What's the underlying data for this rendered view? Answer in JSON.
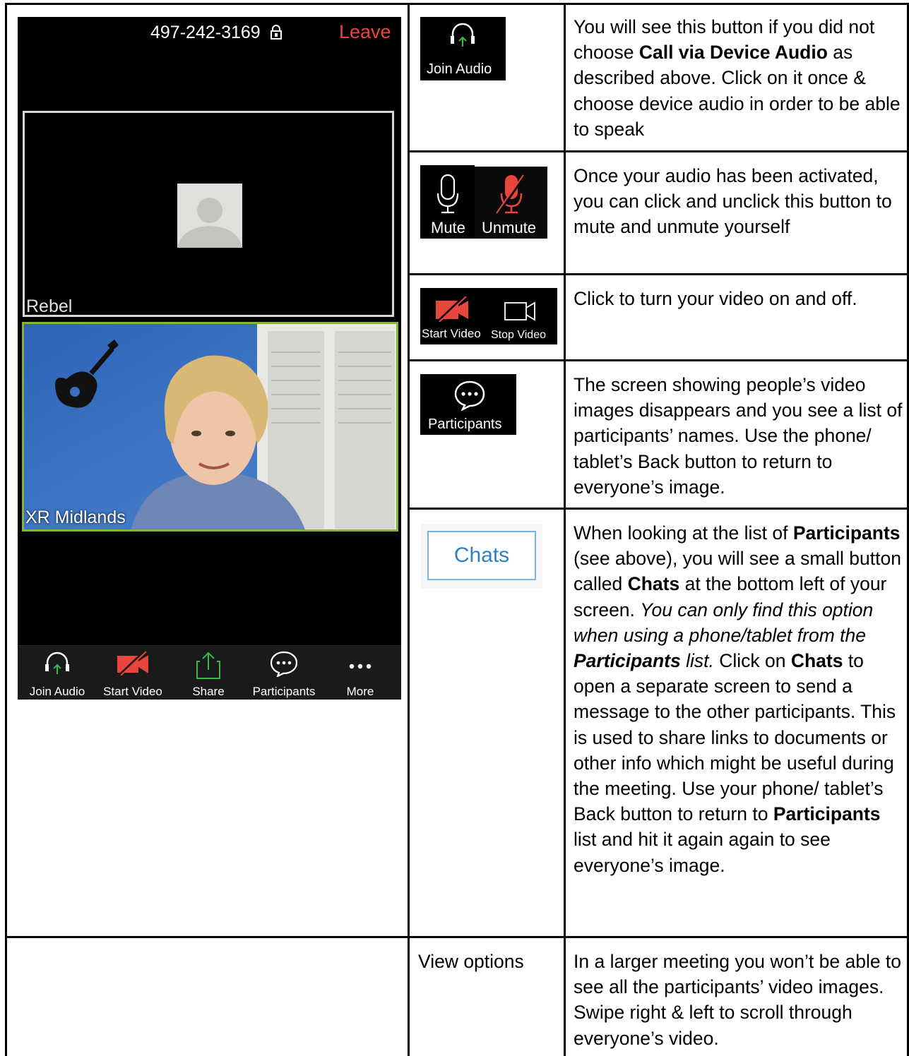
{
  "phone": {
    "meeting_id": "497-242-3169",
    "leave_label": "Leave",
    "tiles": [
      {
        "name": "Rebel"
      },
      {
        "name": "XR Midlands"
      }
    ],
    "toolbar": [
      {
        "label": "Join Audio",
        "icon": "headphones-icon"
      },
      {
        "label": "Start Video",
        "icon": "video-off-icon"
      },
      {
        "label": "Share",
        "icon": "share-icon"
      },
      {
        "label": "Participants",
        "icon": "chat-bubble-icon"
      },
      {
        "label": "More",
        "icon": "more-dots-icon"
      }
    ]
  },
  "rows": {
    "join_audio": {
      "btn_label": "Join Audio",
      "desc_1": "You will see this button if you did not choose ",
      "desc_bold": "Call via Device Audio",
      "desc_2": " as described above. Click on it once & choose device audio in order to be able to speak"
    },
    "mute": {
      "mute_label": "Mute",
      "unmute_label": "Unmute",
      "desc": "Once your audio has been activated, you can click and unclick this button to mute and unmute yourself"
    },
    "video": {
      "start_label": "Start Video",
      "stop_label": "Stop Video",
      "desc": "Click to turn your video on and off."
    },
    "participants": {
      "btn_label": "Participants",
      "desc": "The screen showing people’s video images disappears and you see a list of participants’ names. Use the phone/ tablet’s Back button to return to everyone’s image."
    },
    "chats": {
      "btn_label": "Chats",
      "t1": "When looking at the list of ",
      "b1": "Participants",
      "t2": " (see above), you will see a small button called ",
      "b2": "Chats",
      "t3": " at the bottom left of your screen. ",
      "i1": "You can only find this option when using a phone/tablet from the ",
      "bi1": "Participants",
      "i2": " list.",
      "t4": " Click on ",
      "b3": "Chats",
      "t5": " to open a separate screen to send a message to the other participants. This is used to share links to documents or other info which might be useful during the meeting. Use your phone/ tablet’s Back button to return to ",
      "b4": "Participants",
      "t6": " list and hit it again again to see everyone’s image."
    },
    "view_options": {
      "label": "View options",
      "desc": "In a larger meeting you won’t be able to see all the participants’ video images. Swipe right & left to scroll through everyone’s video."
    }
  },
  "colors": {
    "leave_red": "#e8453c",
    "join_green": "#3cb84a",
    "video_off_red": "#e8453c",
    "active_tile_green": "#86b43a",
    "chats_blue": "#2f7fc1"
  }
}
